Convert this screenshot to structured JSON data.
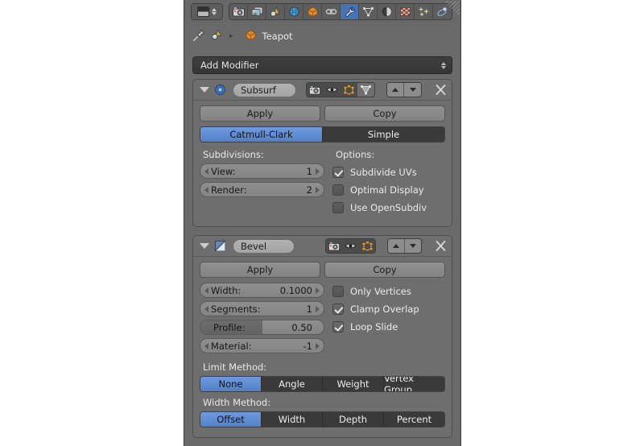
{
  "app": {
    "editor": "Properties",
    "editor_type_icon": "editor-type-icon"
  },
  "header": {
    "tabs": [
      {
        "id": "render",
        "icon": "camera-icon",
        "active": false
      },
      {
        "id": "render-layers",
        "icon": "images-icon",
        "active": false
      },
      {
        "id": "scene",
        "icon": "scene-cone-icon",
        "active": false
      },
      {
        "id": "world",
        "icon": "globe-icon",
        "active": false
      },
      {
        "id": "object",
        "icon": "orange-cube-icon",
        "active": false
      },
      {
        "id": "constraints",
        "icon": "chain-link-icon",
        "active": false
      },
      {
        "id": "modifiers",
        "icon": "wrench-icon",
        "active": true
      },
      {
        "id": "data",
        "icon": "mesh-triangle-icon",
        "active": false
      },
      {
        "id": "material",
        "icon": "material-sphere-icon",
        "active": false
      },
      {
        "id": "texture",
        "icon": "checker-texture-icon",
        "active": false
      },
      {
        "id": "particles",
        "icon": "particles-icon",
        "active": false
      },
      {
        "id": "physics",
        "icon": "physics-orbit-icon",
        "active": false
      }
    ]
  },
  "breadcrumb": {
    "pin_icon": "pin-icon",
    "context_icon": "scene-cone-icon",
    "separator": "▸",
    "object_icon": "orange-cube-icon",
    "object_name": "Teapot"
  },
  "add_modifier": {
    "label": "Add Modifier",
    "dropdown_icon": "updown-arrows-icon"
  },
  "modifiers": [
    {
      "id": "subsurf",
      "icon": "subsurf-icon",
      "name": "Subsurf",
      "expand_icon": "triangle-down-icon",
      "display_toggles": [
        {
          "id": "render",
          "icon": "camera-icon",
          "on": true
        },
        {
          "id": "realtime",
          "icon": "eye-icon",
          "on": true
        },
        {
          "id": "editmode",
          "icon": "edit-mode-icon",
          "on": true
        },
        {
          "id": "oncage",
          "icon": "cage-triangle-icon",
          "on": false
        }
      ],
      "move_up_icon": "triangle-up-icon",
      "move_down_icon": "triangle-down-icon",
      "close_icon": "close-x-icon",
      "apply_label": "Apply",
      "copy_label": "Copy",
      "subdivision_type": {
        "options": [
          "Catmull-Clark",
          "Simple"
        ],
        "selected": "Catmull-Clark"
      },
      "subdivisions_label": "Subdivisions:",
      "fields": [
        {
          "id": "view",
          "label": "View:",
          "value": "1"
        },
        {
          "id": "render",
          "label": "Render:",
          "value": "2"
        }
      ],
      "options_label": "Options:",
      "checkboxes": [
        {
          "id": "subdivide-uvs",
          "label": "Subdivide UVs",
          "checked": true
        },
        {
          "id": "optimal-display",
          "label": "Optimal Display",
          "checked": false
        },
        {
          "id": "use-opensubdiv",
          "label": "Use OpenSubdiv",
          "checked": false
        }
      ]
    },
    {
      "id": "bevel",
      "icon": "bevel-icon",
      "name": "Bevel",
      "expand_icon": "triangle-down-icon",
      "display_toggles": [
        {
          "id": "render",
          "icon": "camera-icon",
          "on": true
        },
        {
          "id": "realtime",
          "icon": "eye-icon",
          "on": true
        },
        {
          "id": "editmode",
          "icon": "edit-mode-icon",
          "on": true
        }
      ],
      "move_up_icon": "triangle-up-icon",
      "move_down_icon": "triangle-down-icon",
      "close_icon": "close-x-icon",
      "apply_label": "Apply",
      "copy_label": "Copy",
      "fields": [
        {
          "id": "width",
          "label": "Width:",
          "value": "0.1000",
          "slider": false,
          "fill_pct": 0
        },
        {
          "id": "segments",
          "label": "Segments:",
          "value": "1",
          "slider": false,
          "fill_pct": 0
        },
        {
          "id": "profile",
          "label": "Profile:",
          "value": "0.50",
          "slider": true,
          "fill_pct": 50
        },
        {
          "id": "material",
          "label": "Material:",
          "value": "-1",
          "slider": false,
          "fill_pct": 0
        }
      ],
      "checkboxes": [
        {
          "id": "only-vertices",
          "label": "Only Vertices",
          "checked": false
        },
        {
          "id": "clamp-overlap",
          "label": "Clamp Overlap",
          "checked": true
        },
        {
          "id": "loop-slide",
          "label": "Loop Slide",
          "checked": true
        }
      ],
      "limit_method": {
        "label": "Limit Method:",
        "options": [
          "None",
          "Angle",
          "Weight",
          "Vertex Group"
        ],
        "selected": "None"
      },
      "width_method": {
        "label": "Width Method:",
        "options": [
          "Offset",
          "Width",
          "Depth",
          "Percent"
        ],
        "selected": "Offset"
      }
    }
  ],
  "colors": {
    "accent_blue": "#5280c8",
    "panel_bg": "#6e6e6e",
    "editor_bg": "#6a6a6a",
    "header_bg": "#686868",
    "field_grey": "#8a8a8a",
    "enum_dark": "#3a3a3a",
    "text_light": "#ececec",
    "text_dark": "#1b1b1b"
  }
}
